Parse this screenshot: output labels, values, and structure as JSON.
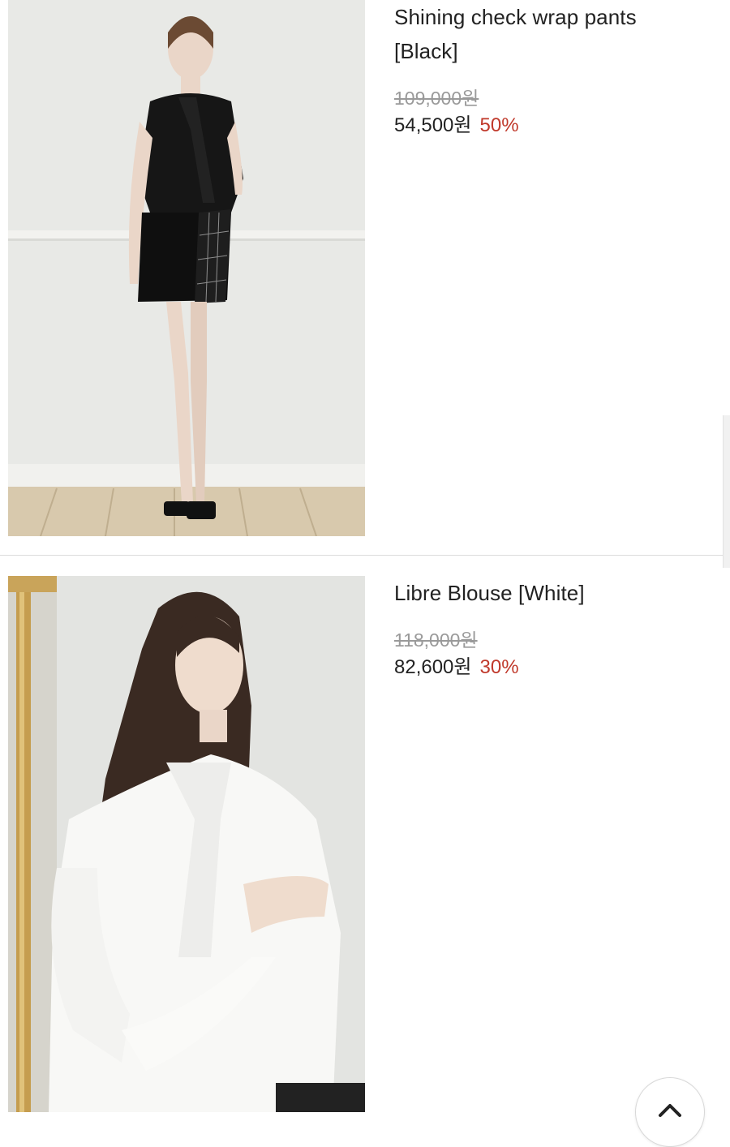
{
  "products": [
    {
      "name": "Shining check wrap pants [Black]",
      "original_price": "109,000원",
      "sale_price": "54,500원",
      "discount": "50%"
    },
    {
      "name": "Libre Blouse [White]",
      "original_price": "118,000원",
      "sale_price": "82,600원",
      "discount": "30%"
    }
  ],
  "colors": {
    "discount": "#c0392b",
    "original_price": "#9a9a9a",
    "text": "#222222",
    "divider": "#dcdcdc"
  },
  "icons": [
    "chevron-up-icon"
  ]
}
